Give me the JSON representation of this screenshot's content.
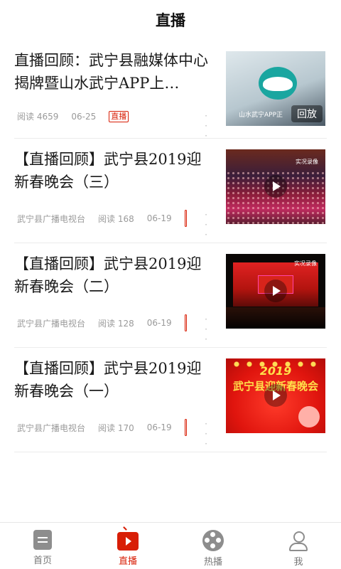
{
  "header": {
    "title": "直播"
  },
  "feed": [
    {
      "title": "直播回顾：武宁县融媒体中心揭牌暨山水武宁APP上…",
      "source": "",
      "reads": "阅读 4659",
      "date": "06-25",
      "tag": "直播",
      "thumb_caption": "山水武宁APP正",
      "thumb_badge": "回放"
    },
    {
      "title": "【直播回顾】武宁县2019迎新春晚会（三）",
      "source": "武宁县广播电视台",
      "reads": "阅读 168",
      "date": "06-19",
      "thumb_caption": "实况录像"
    },
    {
      "title": "【直播回顾】武宁县2019迎新春晚会（二）",
      "source": "武宁县广播电视台",
      "reads": "阅读 128",
      "date": "06-19",
      "thumb_caption": "实况录像"
    },
    {
      "title": "【直播回顾】武宁县2019迎新春晚会（一）",
      "source": "武宁县广播电视台",
      "reads": "阅读 170",
      "date": "06-19",
      "thumb_year": "2019",
      "thumb_banner": "武宁县迎新春晚会"
    }
  ],
  "more_icon": "vertical-dots",
  "tabbar": {
    "tabs": [
      {
        "label": "首页",
        "icon": "home-icon"
      },
      {
        "label": "直播",
        "icon": "tv-icon",
        "active": true
      },
      {
        "label": "热播",
        "icon": "film-reel-icon"
      },
      {
        "label": "我",
        "icon": "user-icon"
      }
    ]
  },
  "colors": {
    "accent": "#d81e06",
    "inactive": "#8d8d8d"
  }
}
